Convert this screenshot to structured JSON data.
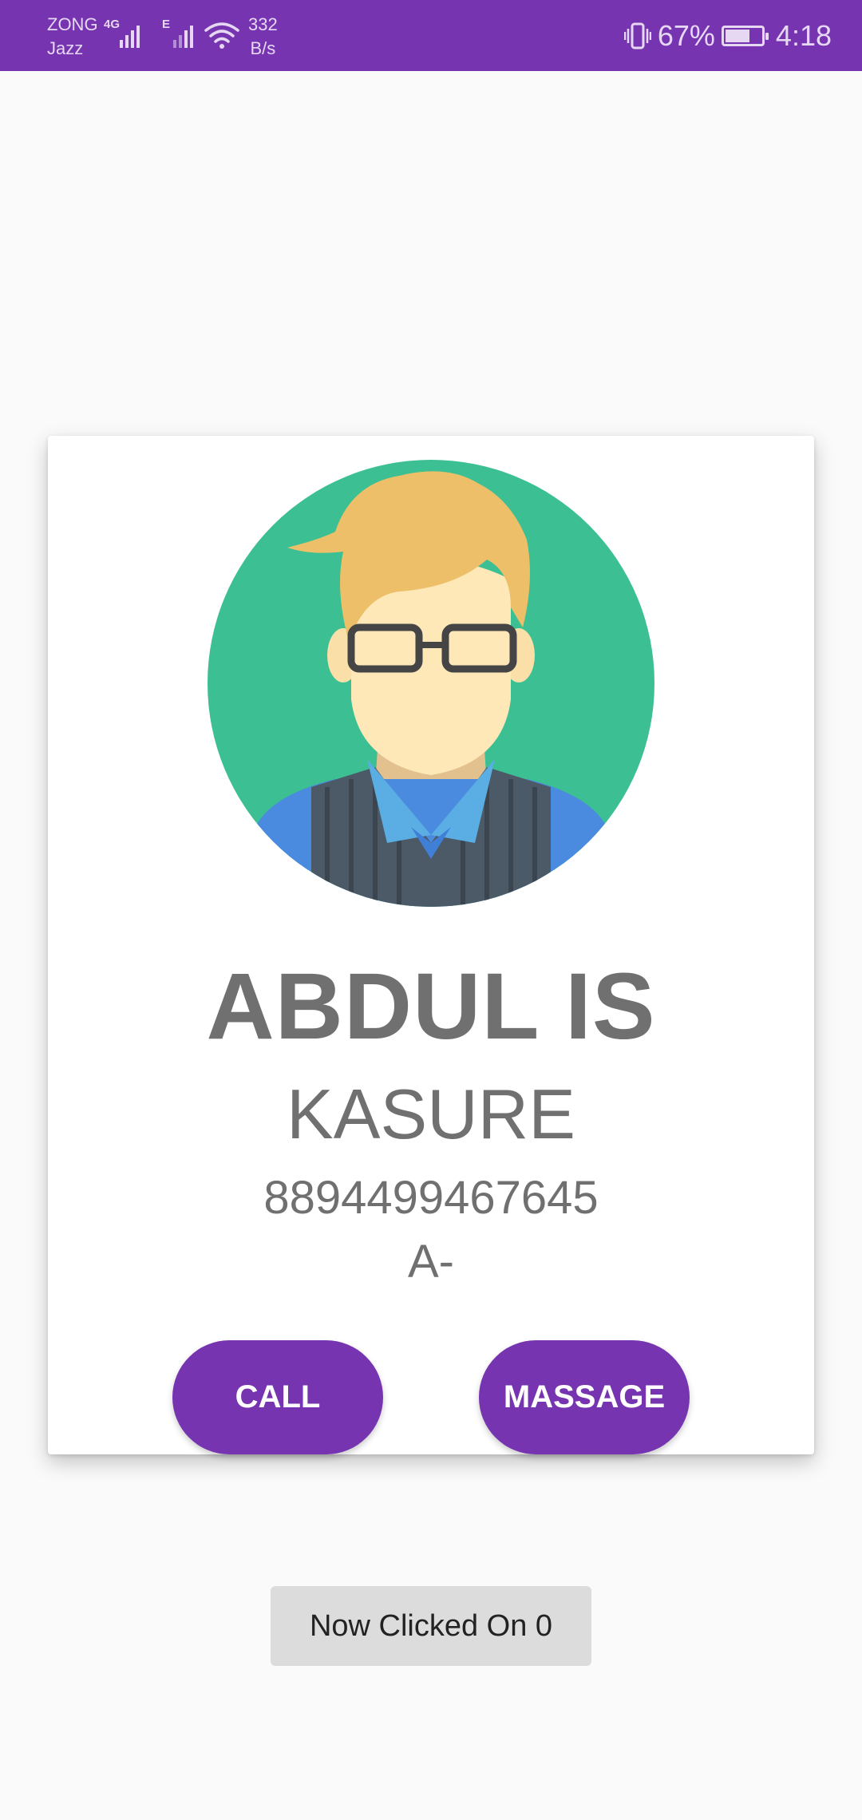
{
  "status_bar": {
    "carrier_top": "ZONG",
    "carrier_bottom": "Jazz",
    "network_tag_1": "4G",
    "network_tag_2": "E",
    "speed_value": "332",
    "speed_unit": "B/s",
    "battery_percent": "67%",
    "battery_level": 0.67,
    "time": "4:18",
    "icons": [
      "signal-icon",
      "wifi-icon",
      "vibrate-icon",
      "battery-charging-icon"
    ],
    "background_color": "#7734b0"
  },
  "contact": {
    "avatar_icon": "person-avatar-icon",
    "name": "ABDUL IS",
    "surname": "KASURE",
    "phone": "8894499467645",
    "blood_group": "A-"
  },
  "actions": {
    "call_label": "CALL",
    "message_label": "MASSAGE",
    "accent_color": "#7734b0"
  },
  "toast": {
    "text": "Now Clicked On 0"
  }
}
